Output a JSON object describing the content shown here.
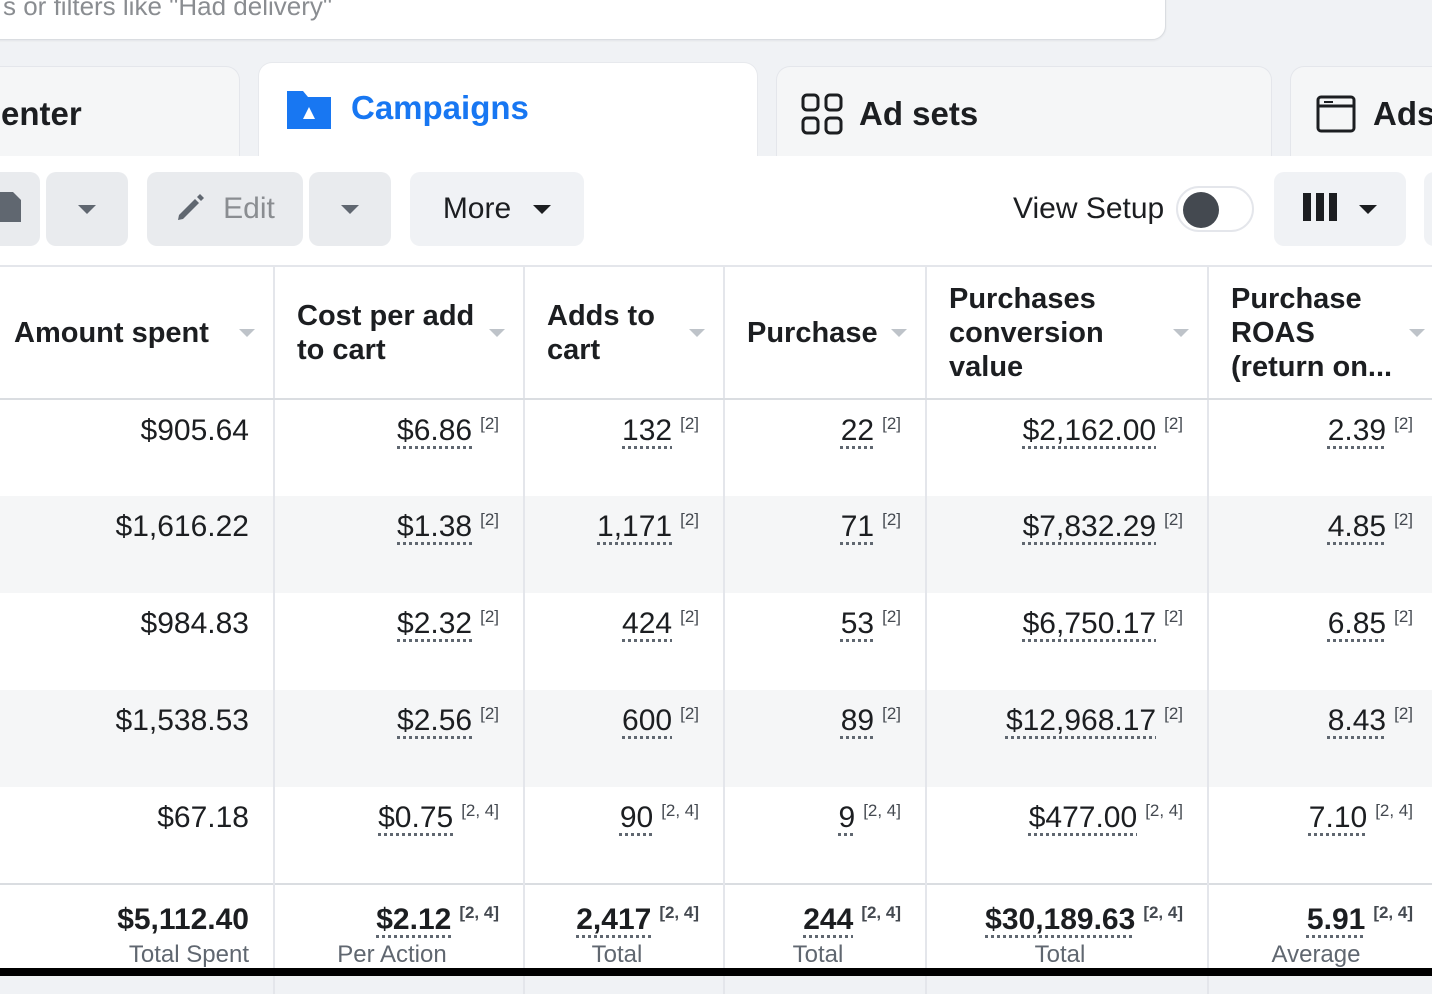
{
  "filter_hint": "s or filters like \"Had delivery\"",
  "tabs": [
    {
      "label": "enter",
      "icon": "none"
    },
    {
      "label": "Campaigns",
      "icon": "campaign-folder-icon"
    },
    {
      "label": "Ad sets",
      "icon": "grid-icon"
    },
    {
      "label": "Ads",
      "icon": "ad-window-icon"
    }
  ],
  "toolbar": {
    "edit_label": "Edit",
    "more_label": "More",
    "view_setup_label": "View Setup",
    "view_setup_on": false
  },
  "colors": {
    "accent": "#1877f2",
    "stripe": "#f5f6f7"
  },
  "table": {
    "headers": [
      "Amount spent",
      "Cost per add to cart",
      "Adds to cart",
      "Purchase",
      "Purchases conversion value",
      "Purchase ROAS (return on..."
    ],
    "rows": [
      {
        "cells": [
          "$905.64",
          "$6.86",
          "132",
          "22",
          "$2,162.00",
          "2.39"
        ],
        "note": "[2]"
      },
      {
        "cells": [
          "$1,616.22",
          "$1.38",
          "1,171",
          "71",
          "$7,832.29",
          "4.85"
        ],
        "note": "[2]"
      },
      {
        "cells": [
          "$984.83",
          "$2.32",
          "424",
          "53",
          "$6,750.17",
          "6.85"
        ],
        "note": "[2]"
      },
      {
        "cells": [
          "$1,538.53",
          "$2.56",
          "600",
          "89",
          "$12,968.17",
          "8.43"
        ],
        "note": "[2]"
      },
      {
        "cells": [
          "$67.18",
          "$0.75",
          "90",
          "9",
          "$477.00",
          "7.10"
        ],
        "note": "[2, 4]"
      }
    ],
    "totals": {
      "cells": [
        "$5,112.40",
        "$2.12",
        "2,417",
        "244",
        "$30,189.63",
        "5.91"
      ],
      "note": "[2, 4]",
      "captions": [
        "Total Spent",
        "Per Action",
        "Total",
        "Total",
        "Total",
        "Average"
      ]
    }
  }
}
